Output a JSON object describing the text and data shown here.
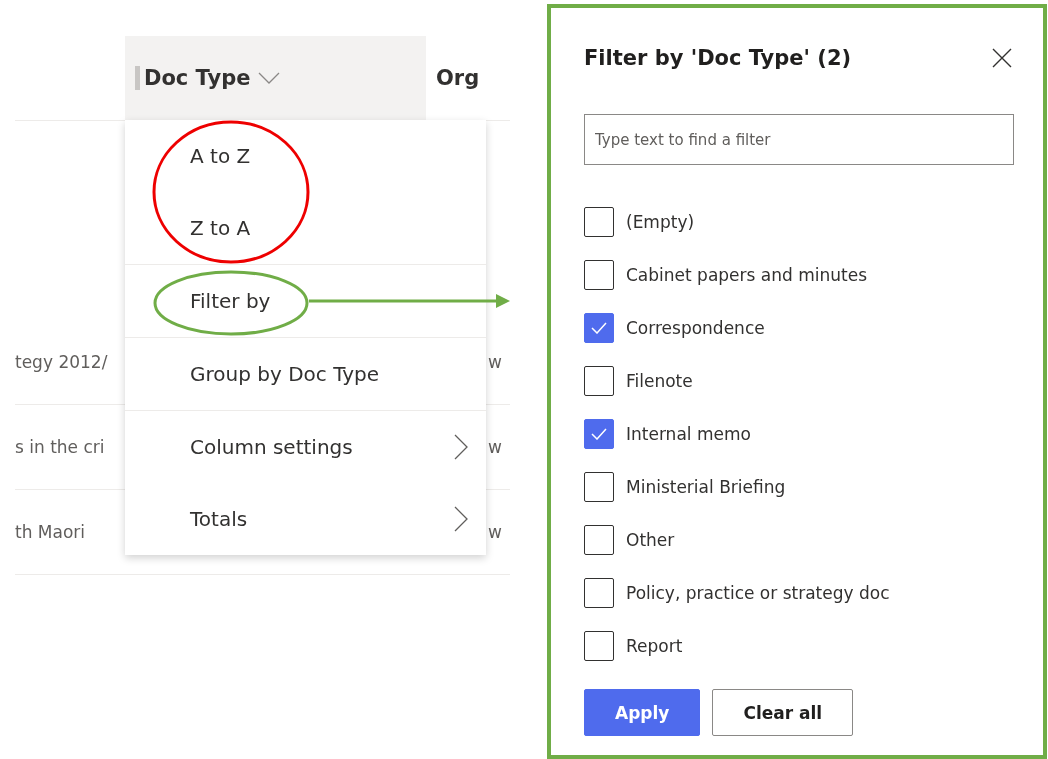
{
  "table": {
    "columns": [
      {
        "label": "Doc Type",
        "selected": true
      },
      {
        "label": "Org",
        "selected": false
      }
    ],
    "rows": [
      {
        "title": "tegy 2012/",
        "org": "w"
      },
      {
        "title": "s in the cri",
        "org": "w"
      },
      {
        "title": "th Maori",
        "org": "w"
      }
    ]
  },
  "menu": {
    "sections": [
      [
        {
          "label": "A to Z",
          "submenu": false
        },
        {
          "label": "Z to A",
          "submenu": false
        }
      ],
      [
        {
          "label": "Filter by",
          "submenu": false
        }
      ],
      [
        {
          "label": "Group by Doc Type",
          "submenu": false
        }
      ],
      [
        {
          "label": "Column settings",
          "submenu": true
        },
        {
          "label": "Totals",
          "submenu": true
        }
      ]
    ]
  },
  "filter_panel": {
    "title": "Filter by 'Doc Type' (2)",
    "search": {
      "placeholder": "Type text to find a filter"
    },
    "options": [
      {
        "label": "(Empty)",
        "checked": false
      },
      {
        "label": "Cabinet papers and minutes",
        "checked": false
      },
      {
        "label": "Correspondence",
        "checked": true
      },
      {
        "label": "Filenote",
        "checked": false
      },
      {
        "label": "Internal memo",
        "checked": true
      },
      {
        "label": "Ministerial Briefing",
        "checked": false
      },
      {
        "label": "Other",
        "checked": false
      },
      {
        "label": "Policy, practice or strategy doc",
        "checked": false
      },
      {
        "label": "Report",
        "checked": false
      }
    ],
    "buttons": [
      {
        "label": "Apply",
        "kind": "primary"
      },
      {
        "label": "Clear all",
        "kind": "default"
      }
    ]
  }
}
